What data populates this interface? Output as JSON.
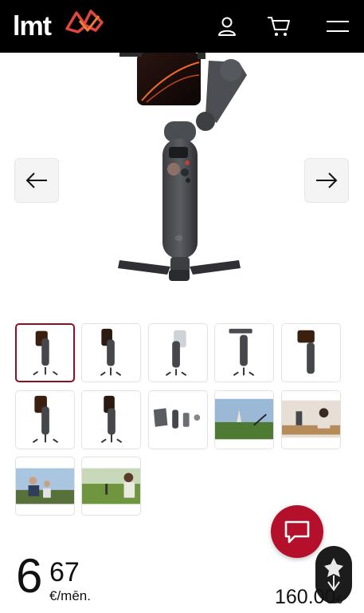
{
  "header": {
    "logo_text": "lmt",
    "logo_mark_color": "#e1473d",
    "icons": [
      "user-icon",
      "cart-icon",
      "menu-icon"
    ]
  },
  "gallery": {
    "main_image": "dji-gimbal-product-image",
    "prev_icon": "arrow-left-icon",
    "next_icon": "arrow-right-icon",
    "thumbnails_count": 12,
    "active_thumbnail": 0,
    "active_border_color": "#8c0f24"
  },
  "price": {
    "integer": "6",
    "decimal": "67",
    "unit": "€/mēn.",
    "full_price": "160.00",
    "full_currency": "€"
  },
  "chat": {
    "color": "#b5102b",
    "icon": "chat-bubble-icon"
  },
  "badge": {
    "icon": "leaf-badge-icon"
  }
}
